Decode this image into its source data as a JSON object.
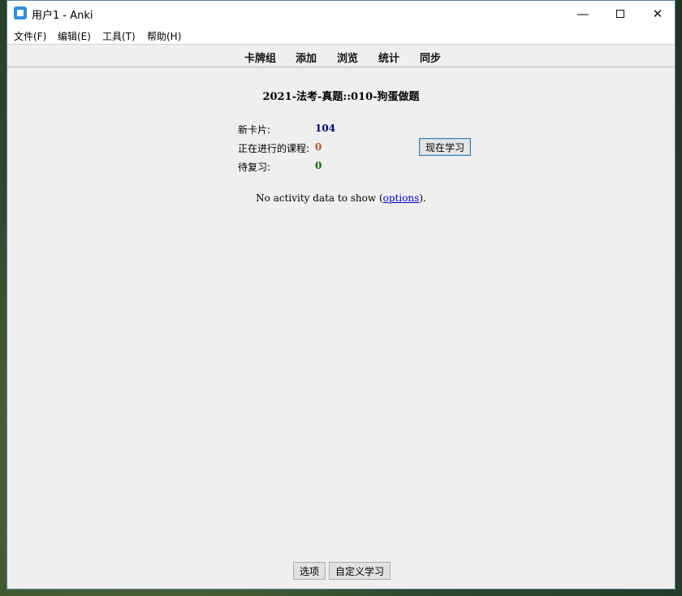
{
  "window": {
    "title": "用户1 - Anki",
    "minimize": "—",
    "close": "✕"
  },
  "menu": {
    "file": "文件(F)",
    "edit": "编辑(E)",
    "tools": "工具(T)",
    "help": "帮助(H)"
  },
  "toolbar": {
    "decks": "卡牌组",
    "add": "添加",
    "browse": "浏览",
    "stats": "统计",
    "sync": "同步"
  },
  "overview": {
    "deck_title": "2021-法考-真题::010-狗蛋做题",
    "stats": [
      {
        "label": "新卡片:",
        "value": "104",
        "color": "#000080"
      },
      {
        "label": "正在进行的课程:",
        "value": "0",
        "color": "#c35617"
      },
      {
        "label": "待复习:",
        "value": "0",
        "color": "#007700"
      }
    ],
    "study_now": "现在学习",
    "activity_prefix": "No activity data to show (",
    "activity_link": "options",
    "activity_suffix": ")."
  },
  "bottom": {
    "options": "选项",
    "custom_study": "自定义学习"
  }
}
